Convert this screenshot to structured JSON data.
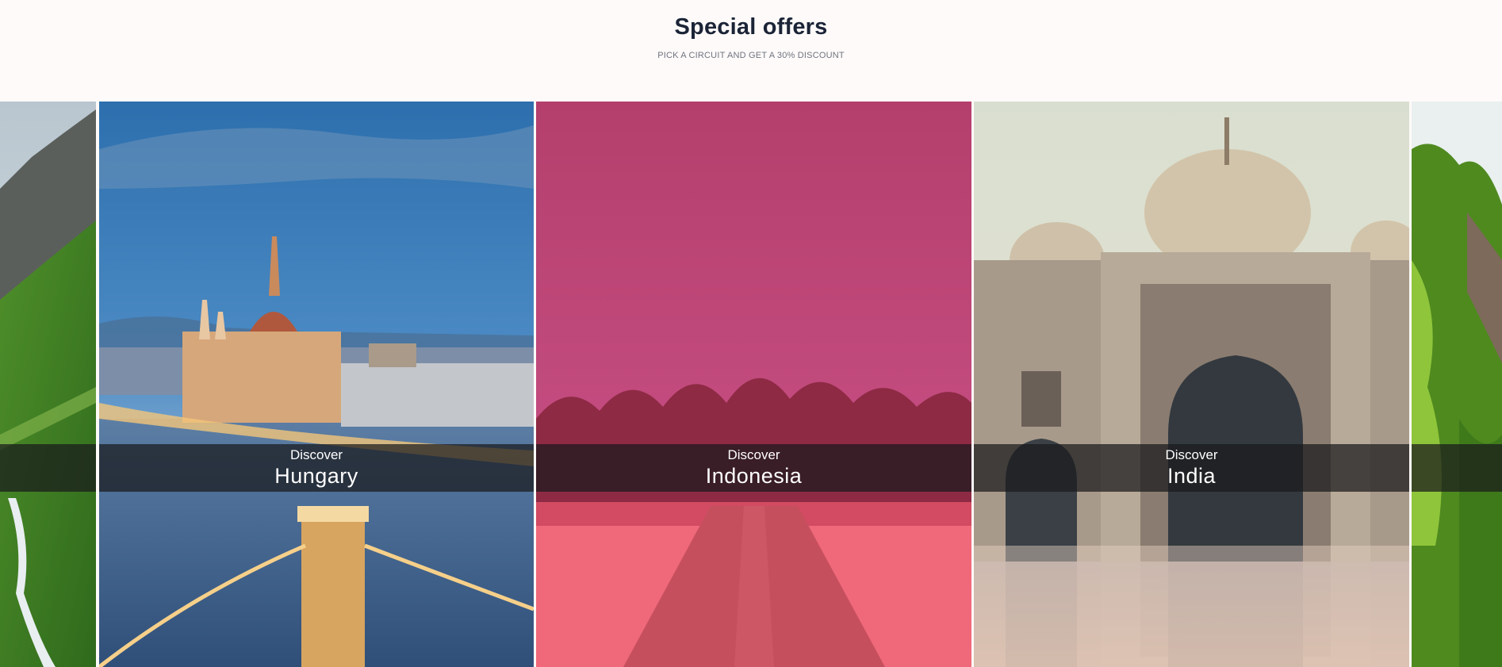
{
  "header": {
    "title": "Special offers",
    "subtitle": "PICK A CIRCUIT AND GET A 30% DISCOUNT"
  },
  "offers": [
    {
      "prefix": "Discover",
      "destination": "Hungary"
    },
    {
      "prefix": "Discover",
      "destination": "Indonesia"
    },
    {
      "prefix": "Discover",
      "destination": "India"
    }
  ],
  "colors": {
    "page_background": "#fefaf9",
    "title": "#1b2437",
    "subtitle": "#6f7480",
    "band_overlay": "rgba(25,25,28,0.72)",
    "indonesia_tint": "#c94677"
  }
}
